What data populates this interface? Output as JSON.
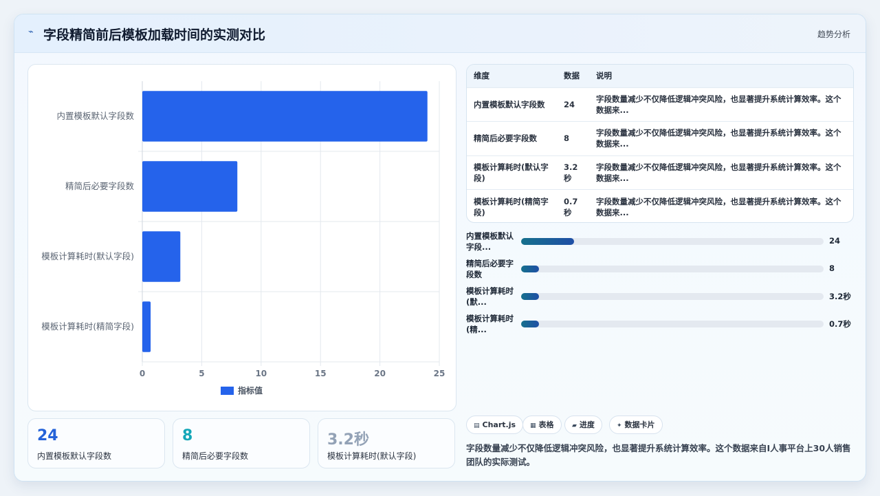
{
  "header": {
    "icon": "chart-line-icon",
    "title": "字段精简前后模板加载时间的实测对比",
    "right_label": "趋势分析"
  },
  "chart_data": {
    "type": "bar",
    "orientation": "horizontal",
    "categories": [
      "内置模板默认字段数",
      "精简后必要字段数",
      "模板计算耗时(默认字段)",
      "模板计算耗时(精简字段)"
    ],
    "series": [
      {
        "name": "指标值",
        "values": [
          24,
          8,
          3.2,
          0.7
        ],
        "color": "#2563eb"
      }
    ],
    "xlim": [
      0,
      25
    ],
    "xticks": [
      "0",
      "5",
      "10",
      "15",
      "20",
      "25"
    ],
    "grid": true,
    "legend": "bottom"
  },
  "kpis": [
    {
      "value": "24",
      "label": "内置模板默认字段数",
      "color": "#2563d9"
    },
    {
      "value": "8",
      "label": "精简后必要字段数",
      "color": "#14a7b8"
    },
    {
      "value": "3.2秒",
      "label": "模板计算耗时(默认字段)",
      "color": "#93a2b6"
    }
  ],
  "table": {
    "headers": [
      "维度",
      "数据",
      "说明"
    ],
    "rows": [
      [
        "内置模板默认字段数",
        "24",
        "字段数量减少不仅降低逻辑冲突风险，也显著提升系统计算效率。这个数据来..."
      ],
      [
        "精简后必要字段数",
        "8",
        "字段数量减少不仅降低逻辑冲突风险，也显著提升系统计算效率。这个数据来..."
      ],
      [
        "模板计算耗时(默认字段)",
        "3.2秒",
        "字段数量减少不仅降低逻辑冲突风险，也显著提升系统计算效率。这个数据来..."
      ],
      [
        "模板计算耗时(精简字段)",
        "0.7秒",
        "字段数量减少不仅降低逻辑冲突风险，也显著提升系统计算效率。这个数据来..."
      ]
    ]
  },
  "progress": [
    {
      "label": "内置模板默认字段...",
      "value": "24",
      "fraction": 0.176
    },
    {
      "label": "精简后必要字段数",
      "value": "8",
      "fraction": 0.059
    },
    {
      "label": "模板计算耗时(默...",
      "value": "3.2秒",
      "fraction": 0.059
    },
    {
      "label": "模板计算耗时(精...",
      "value": "0.7秒",
      "fraction": 0.059
    }
  ],
  "chips": [
    {
      "icon": "chart-icon",
      "glyph": "▤",
      "label": "Chart.js"
    },
    {
      "icon": "table-icon",
      "glyph": "▦",
      "label": "表格"
    },
    {
      "icon": "progress-icon",
      "glyph": "▰",
      "label": "进度"
    },
    {
      "icon": "card-icon",
      "glyph": "✦",
      "label": "数据卡片"
    }
  ],
  "footnote": "字段数量减少不仅降低逻辑冲突风险，也显著提升系统计算效率。这个数据来自I人事平台上30人销售团队的实际测试。"
}
